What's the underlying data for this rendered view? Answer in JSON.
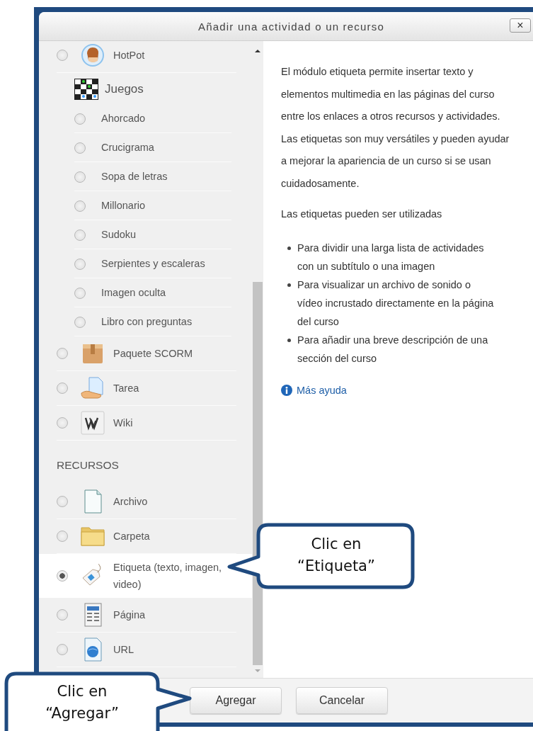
{
  "dialog": {
    "title": "Añadir una actividad o un recurso",
    "close": "×"
  },
  "list": [
    {
      "kind": "module",
      "label": "HotPot",
      "selected": false
    },
    {
      "kind": "group",
      "label": "Juegos",
      "children": [
        {
          "label": "Ahorcado",
          "selected": false
        },
        {
          "label": "Crucigrama",
          "selected": false
        },
        {
          "label": "Sopa de letras",
          "selected": false
        },
        {
          "label": "Millonario",
          "selected": false
        },
        {
          "label": "Sudoku",
          "selected": false
        },
        {
          "label": "Serpientes y escaleras",
          "selected": false
        },
        {
          "label": "Imagen oculta",
          "selected": false
        },
        {
          "label": "Libro con preguntas",
          "selected": false
        }
      ]
    },
    {
      "kind": "module",
      "label": "Paquete SCORM",
      "selected": false
    },
    {
      "kind": "module",
      "label": "Tarea",
      "selected": false
    },
    {
      "kind": "module",
      "label": "Wiki",
      "selected": false
    },
    {
      "kind": "section",
      "label": "RECURSOS"
    },
    {
      "kind": "module",
      "label": "Archivo",
      "selected": false
    },
    {
      "kind": "module",
      "label": "Carpeta",
      "selected": false
    },
    {
      "kind": "module",
      "label": "Etiqueta (texto, imagen, video)",
      "selected": true
    },
    {
      "kind": "module",
      "label": "Página",
      "selected": false
    },
    {
      "kind": "module",
      "label": "URL",
      "selected": false
    }
  ],
  "description": {
    "paragraphs": [
      "El módulo etiqueta permite insertar texto y elementos multimedia en las páginas del curso entre los enlaces a otros recursos y actividades. Las etiquetas son muy versátiles y pueden ayudar a mejorar la apariencia de un curso si se usan cuidadosamente.",
      "Las etiquetas pueden ser utilizadas"
    ],
    "bullets": [
      "Para dividir una larga lista de actividades con un subtítulo o una imagen",
      "Para visualizar un archivo de sonido o vídeo incrustado directamente en la página del curso",
      "Para añadir una breve descripción de una sección del curso"
    ],
    "help_link": "Más ayuda"
  },
  "buttons": [
    {
      "label": "Agregar"
    },
    {
      "label": "Cancelar"
    }
  ],
  "callouts": [
    {
      "text": "Clic en “Etiqueta”"
    },
    {
      "text": "Clic en “Agregar”"
    }
  ]
}
